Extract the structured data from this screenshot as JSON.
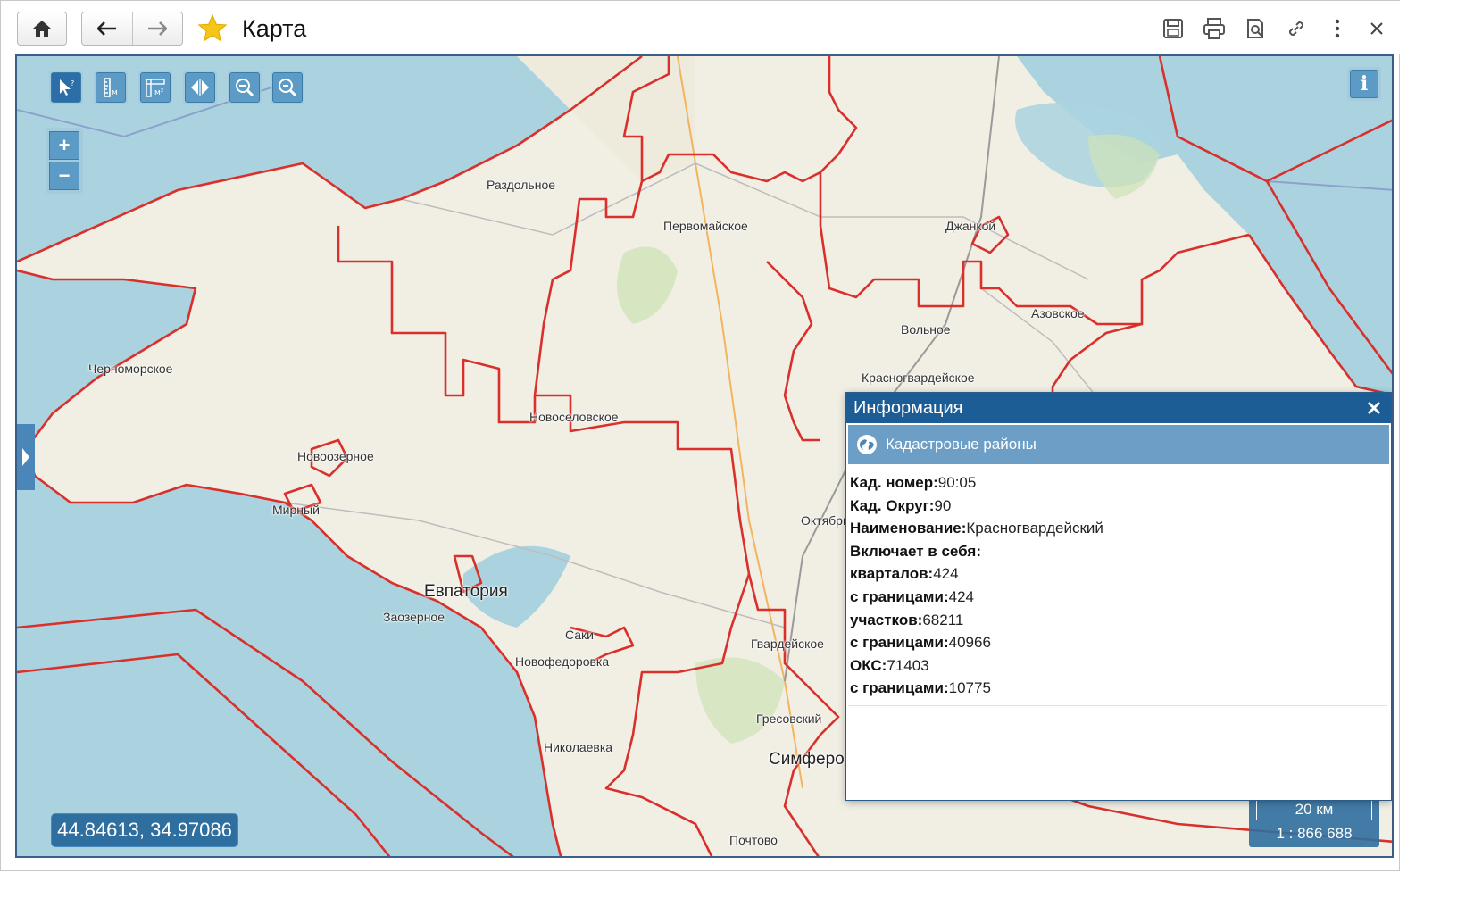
{
  "window": {
    "title": "Карта"
  },
  "titlebar": {
    "icons": [
      "home-icon",
      "back-arrow-icon",
      "forward-arrow-icon",
      "star-icon",
      "save-icon",
      "print-icon",
      "preview-icon",
      "link-icon",
      "more-icon",
      "close-icon"
    ],
    "colors": {
      "star": "#f5c518"
    }
  },
  "map": {
    "toolbar": [
      "select-tool-icon",
      "measure-distance-icon",
      "measure-area-icon",
      "compare-icon",
      "zoom-in-area-icon",
      "zoom-out-area-icon"
    ],
    "zoom": {
      "in_label": "+",
      "out_label": "−"
    },
    "info_label": "i",
    "coords": "44.84613, 34.97086",
    "scale": {
      "distance": "20 км",
      "ratio": "1 : 866 688"
    },
    "places": [
      {
        "name": "Раздольное"
      },
      {
        "name": "Первомайское"
      },
      {
        "name": "Джанкой"
      },
      {
        "name": "Азовское"
      },
      {
        "name": "Вольное"
      },
      {
        "name": "Красногвардейское"
      },
      {
        "name": "Черноморское"
      },
      {
        "name": "Новоселовское"
      },
      {
        "name": "Новоозерное"
      },
      {
        "name": "Мирный"
      },
      {
        "name": "Октябрь"
      },
      {
        "name": "Евпатория"
      },
      {
        "name": "Заозерное"
      },
      {
        "name": "Саки"
      },
      {
        "name": "Гвардейское"
      },
      {
        "name": "Новофедоровка"
      },
      {
        "name": "Гресовский"
      },
      {
        "name": "Николаевка"
      },
      {
        "name": "Симферо"
      },
      {
        "name": "Почтово"
      }
    ],
    "colors": {
      "sea": "#aad3df",
      "land": "#f1eee4",
      "border": "#d9302c"
    }
  },
  "popup": {
    "title": "Информация",
    "layer": "Кадастровые районы",
    "rows": [
      {
        "label": "Кад. номер:",
        "value": "90:05"
      },
      {
        "label": "Кад. Округ:",
        "value": "90"
      },
      {
        "label": "Наименование:",
        "value": "Красногвардейский"
      },
      {
        "label": "Включает в себя:",
        "value": ""
      },
      {
        "label": "кварталов:",
        "value": "424"
      },
      {
        "label": "с границами:",
        "value": "424"
      },
      {
        "label": "участков:",
        "value": "68211"
      },
      {
        "label": "с границами:",
        "value": "40966"
      },
      {
        "label": "ОКС:",
        "value": "71403"
      },
      {
        "label": "с границами:",
        "value": "10775"
      }
    ],
    "colors": {
      "header": "#1d5d96",
      "subheader": "#6d9fc6"
    }
  }
}
